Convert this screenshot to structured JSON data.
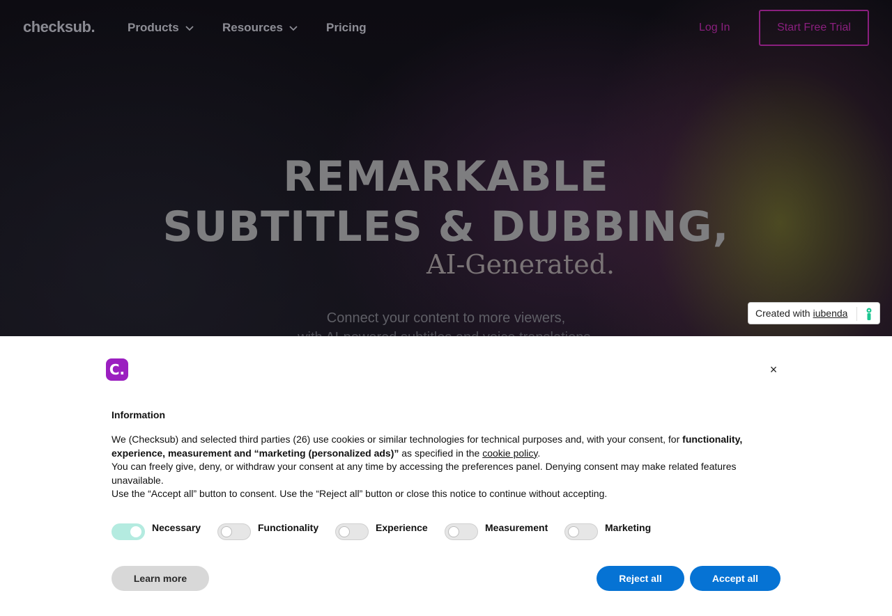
{
  "nav": {
    "logo": "checksub.",
    "items": [
      {
        "label": "Products",
        "has_dropdown": true
      },
      {
        "label": "Resources",
        "has_dropdown": true
      },
      {
        "label": "Pricing",
        "has_dropdown": false
      }
    ],
    "login_label": "Log In",
    "trial_label": "Start Free Trial"
  },
  "hero": {
    "headline_line1": "REMARKABLE",
    "headline_line2": "SUBTITLES & DUBBING,",
    "subheadline": "AI-Generated.",
    "tagline_line1": "Connect your content to more viewers,",
    "tagline_line2": "with AI-powered subtitles and voice translations."
  },
  "iubenda": {
    "prefix": "Created with",
    "link": "iubenda"
  },
  "cookie_banner": {
    "brand_badge": "C.",
    "close_label": "×",
    "title": "Information",
    "paragraph1_start": "We (Checksub) and selected third parties (26) use cookies or similar technologies for technical purposes and, with your consent, for ",
    "paragraph1_bold": "functionality, experience, measurement and “marketing (personalized ads)”",
    "paragraph1_mid": " as specified in the ",
    "paragraph1_link": "cookie policy",
    "paragraph1_end": ".",
    "paragraph2": "You can freely give, deny, or withdraw your consent at any time by accessing the preferences panel. Denying consent may make related features unavailable.",
    "paragraph3": "Use the “Accept all” button to consent. Use the “Reject all” button or close this notice to continue without accepting.",
    "toggles": [
      {
        "label": "Necessary",
        "on": true
      },
      {
        "label": "Functionality",
        "on": false
      },
      {
        "label": "Experience",
        "on": false
      },
      {
        "label": "Measurement",
        "on": false
      },
      {
        "label": "Marketing",
        "on": false
      }
    ],
    "learn_more_label": "Learn more",
    "reject_label": "Reject all",
    "accept_label": "Accept all"
  },
  "colors": {
    "accent": "#8a1f7e",
    "brand_badge": "#9b1fc0",
    "button_blue": "#0673d4",
    "toggle_on": "#b4ebe0"
  }
}
